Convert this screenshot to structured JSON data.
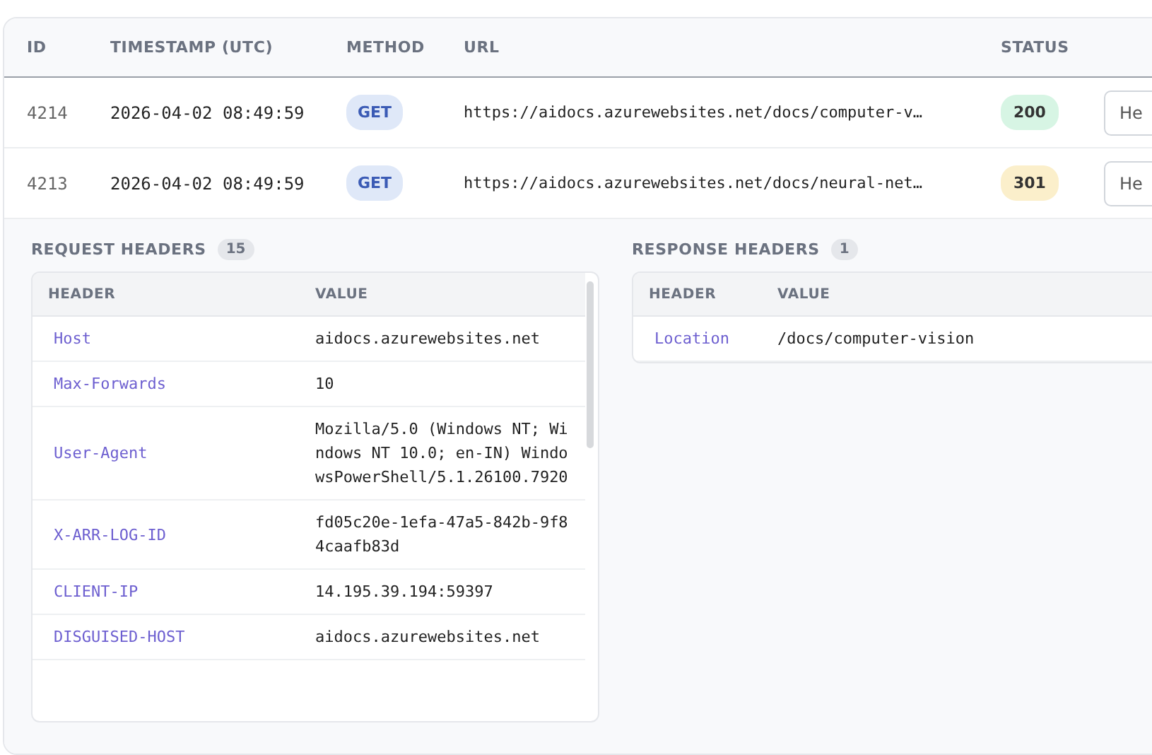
{
  "table": {
    "columns": [
      "ID",
      "TIMESTAMP (UTC)",
      "METHOD",
      "URL",
      "STATUS"
    ],
    "rows": [
      {
        "id": "4214",
        "timestamp": "2026-04-02 08:49:59",
        "method": "GET",
        "url": "https://aidocs.azurewebsites.net/docs/computer-v…",
        "status": "200",
        "color": "#d7f5e4",
        "action": "He"
      },
      {
        "id": "4213",
        "timestamp": "2026-04-02 08:49:59",
        "method": "GET",
        "url": "https://aidocs.azurewebsites.net/docs/neural-net…",
        "status": "301",
        "color": "#fbefcb",
        "action": "He"
      }
    ]
  },
  "details": {
    "request_headers": {
      "title": "REQUEST HEADERS",
      "count": "15",
      "columns": [
        "HEADER",
        "VALUE"
      ],
      "rows": [
        {
          "name": "Host",
          "value": "aidocs.azurewebsites.net"
        },
        {
          "name": "Max-Forwards",
          "value": "10"
        },
        {
          "name": "User-Agent",
          "value": "Mozilla/5.0 (Windows NT; Windows NT 10.0; en-IN) WindowsPowerShell/5.1.26100.7920"
        },
        {
          "name": "X-ARR-LOG-ID",
          "value": "fd05c20e-1efa-47a5-842b-9f84caafb83d"
        },
        {
          "name": "CLIENT-IP",
          "value": "14.195.39.194:59397"
        },
        {
          "name": "DISGUISED-HOST",
          "value": "aidocs.azurewebsites.net"
        }
      ]
    },
    "response_headers": {
      "title": "RESPONSE HEADERS",
      "count": "1",
      "columns": [
        "HEADER",
        "VALUE"
      ],
      "rows": [
        {
          "name": "Location",
          "value": "/docs/computer-vision"
        }
      ]
    }
  }
}
